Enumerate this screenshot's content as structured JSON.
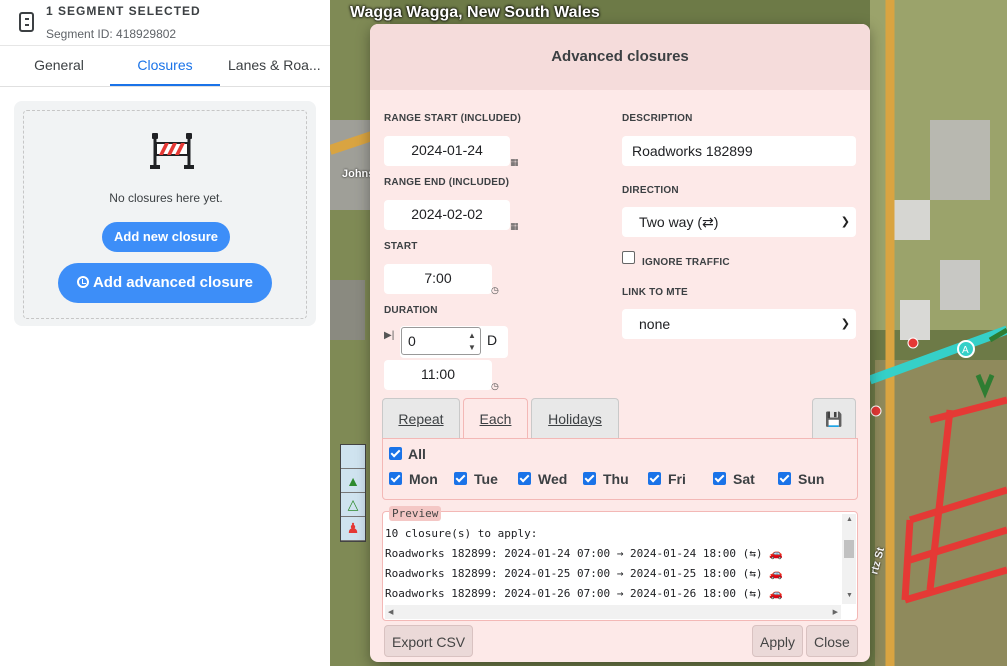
{
  "segment": {
    "title": "1 SEGMENT SELECTED",
    "id_text": "Segment ID: 418929802"
  },
  "tabs": [
    {
      "label": "General"
    },
    {
      "label": "Closures"
    },
    {
      "label": "Lanes & Roa..."
    }
  ],
  "closures_panel": {
    "empty_text": "No closures here yet.",
    "add_label": "Add new closure",
    "add_advanced_label": "Add advanced closure"
  },
  "map": {
    "city": "Wagga Wagga, New South Wales",
    "street_1": "Johns",
    "street_2": "rtz St"
  },
  "dialog": {
    "title": "Advanced closures",
    "range_start_label": "RANGE START (INCLUDED)",
    "range_start_value": "2024-01-24",
    "range_end_label": "RANGE END (INCLUDED)",
    "range_end_value": "2024-02-02",
    "start_label": "START",
    "start_value": "7:00",
    "duration_label": "DURATION",
    "duration_days": "0",
    "duration_days_unit": "D",
    "duration_time": "11:00",
    "description_label": "DESCRIPTION",
    "description_value": "Roadworks 182899",
    "direction_label": "DIRECTION",
    "direction_value": "Two way (⇄)",
    "ignore_traffic_label": "IGNORE TRAFFIC",
    "link_mte_label": "LINK TO MTE",
    "link_mte_value": "none",
    "tabs": {
      "repeat": "Repeat",
      "each": "Each",
      "holidays": "Holidays"
    },
    "all_label": "All",
    "days": [
      "Mon",
      "Tue",
      "Wed",
      "Thu",
      "Fri",
      "Sat",
      "Sun"
    ],
    "preview_label": "Preview",
    "preview_lines": [
      "10 closure(s) to apply:",
      "Roadworks 182899: 2024-01-24 07:00 → 2024-01-24 18:00 (⇆) 🚗",
      "Roadworks 182899: 2024-01-25 07:00 → 2024-01-25 18:00 (⇆) 🚗",
      "Roadworks 182899: 2024-01-26 07:00 → 2024-01-26 18:00 (⇆) 🚗"
    ],
    "export_label": "Export CSV",
    "apply_label": "Apply",
    "close_label": "Close"
  },
  "colors": {
    "accent": "#1a73e8",
    "button_blue": "#3d8ef8",
    "dialog_bg": "#fde9e8",
    "closure_red": "#e53935"
  }
}
